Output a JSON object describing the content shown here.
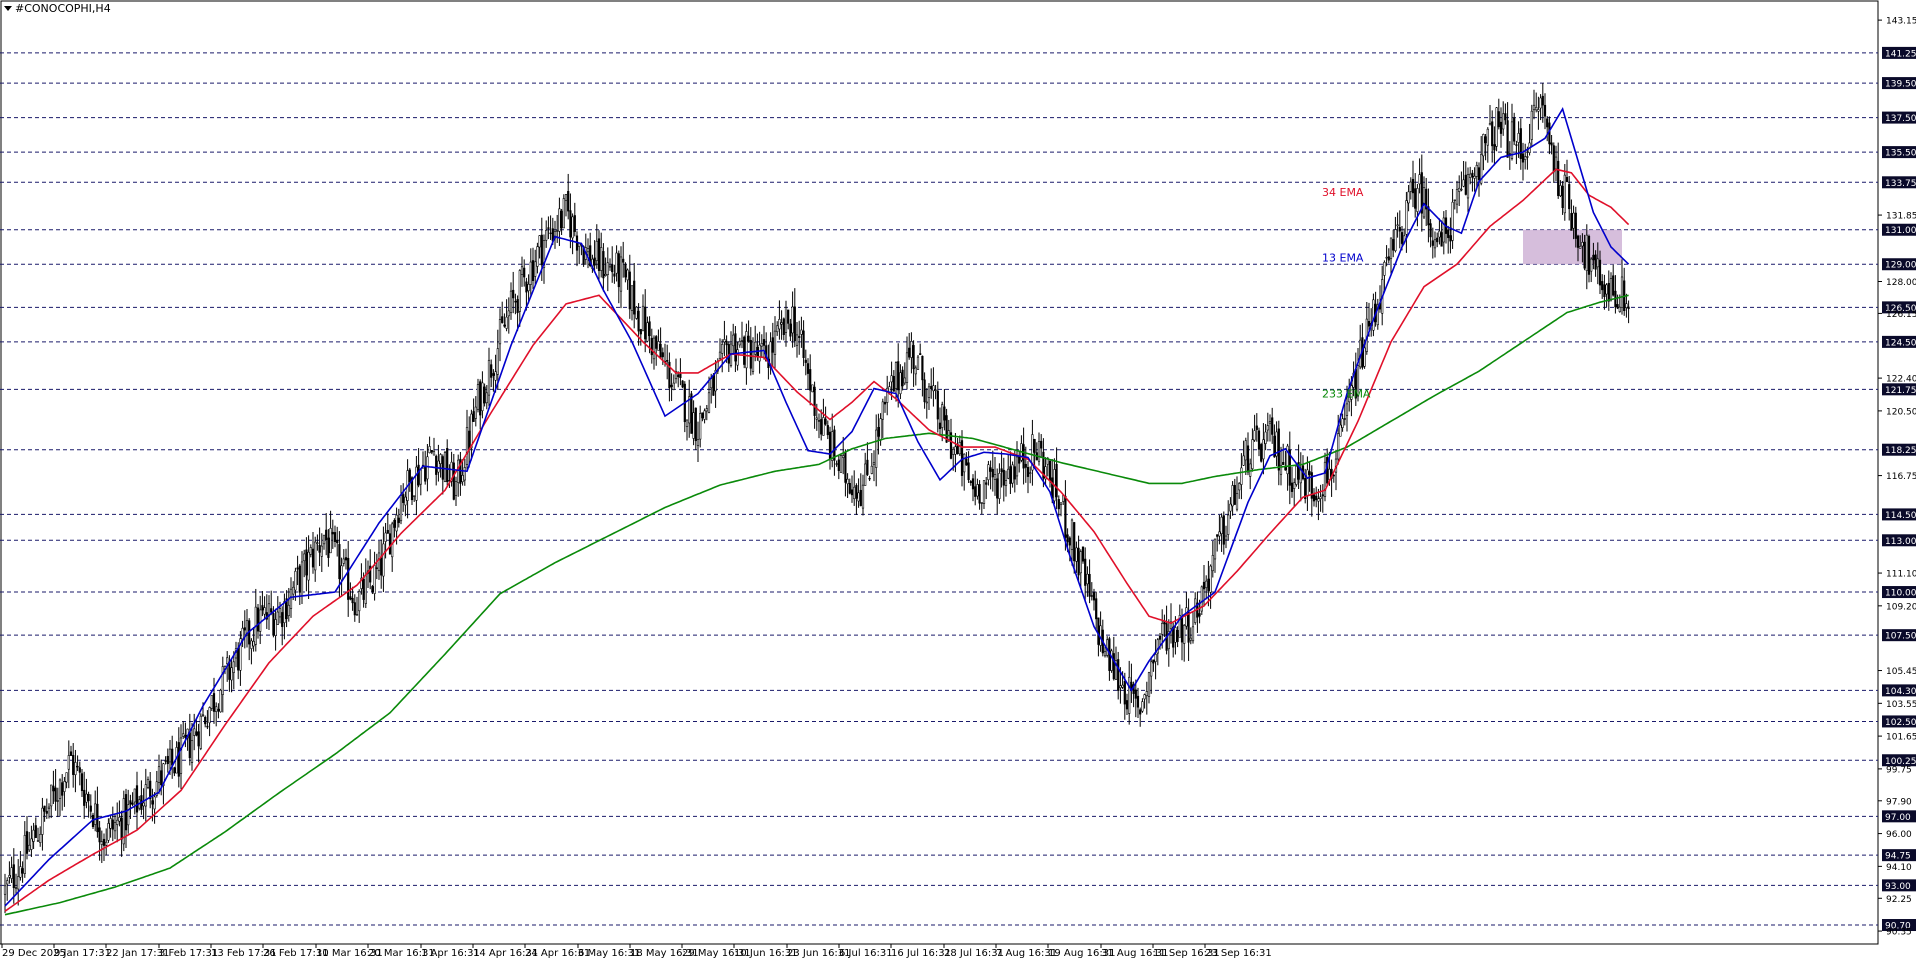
{
  "window": {
    "symbol_title": "#CONOCOPHI,H4"
  },
  "colors": {
    "ema13": "#0000cc",
    "ema34": "#e0102a",
    "ema233": "#0a8a0a",
    "zone": "#c8a8d0",
    "grid": "#1a1a6a",
    "level_box": "#0a0a2a"
  },
  "chart_data": {
    "type": "candlestick",
    "title": "#CONOCOPHI,H4",
    "ylim": [
      89.6,
      144.2
    ],
    "y_ticks": [
      "143.15",
      "131.85",
      "128.00",
      "126.15",
      "122.40",
      "120.50",
      "116.75",
      "111.10",
      "109.20",
      "105.45",
      "103.55",
      "101.65",
      "99.75",
      "97.90",
      "96.00",
      "94.10",
      "92.25",
      "90.35"
    ],
    "levels": [
      "141.25",
      "139.50",
      "137.50",
      "135.50",
      "133.75",
      "131.00",
      "129.00",
      "126.50",
      "124.50",
      "121.75",
      "118.25",
      "114.50",
      "113.00",
      "110.00",
      "107.50",
      "104.30",
      "102.50",
      "100.25",
      "97.00",
      "94.75",
      "93.00",
      "90.70"
    ],
    "x_labels": [
      "29 Dec 2025",
      "9 Jan 17:31",
      "22 Jan 17:31",
      "3 Feb 17:31",
      "13 Feb 17:31",
      "26 Feb 17:31",
      "10 Mar 16:31",
      "20 Mar 16:31",
      "1 Apr 16:31",
      "14 Apr 16:31",
      "24 Apr 16:31",
      "6 May 16:31",
      "18 May 16:31",
      "29 May 16:31",
      "10 Jun 16:31",
      "23 Jun 16:31",
      "6 Jul 16:31",
      "16 Jul 16:31",
      "28 Jul 16:31",
      "7 Aug 16:31",
      "19 Aug 16:31",
      "31 Aug 16:31",
      "11 Sep 16:31",
      "23 Sep 16:31"
    ],
    "anchors": {
      "close": [
        [
          0,
          92.6
        ],
        [
          15,
          96.2
        ],
        [
          30,
          100.3
        ],
        [
          45,
          95.9
        ],
        [
          55,
          97.0
        ],
        [
          65,
          98.5
        ],
        [
          80,
          100.4
        ],
        [
          95,
          103.8
        ],
        [
          115,
          108.4
        ],
        [
          125,
          108.8
        ],
        [
          145,
          113.3
        ],
        [
          160,
          109.4
        ],
        [
          170,
          111.2
        ],
        [
          180,
          115.6
        ],
        [
          195,
          118.2
        ],
        [
          205,
          116.0
        ],
        [
          215,
          121.0
        ],
        [
          230,
          126.5
        ],
        [
          245,
          130.4
        ],
        [
          255,
          132.0
        ],
        [
          265,
          129.5
        ],
        [
          280,
          128.4
        ],
        [
          292,
          125.0
        ],
        [
          302,
          122.6
        ],
        [
          315,
          119.6
        ],
        [
          330,
          124.5
        ],
        [
          345,
          123.5
        ],
        [
          358,
          126.0
        ],
        [
          370,
          120.0
        ],
        [
          380,
          117.0
        ],
        [
          390,
          116.0
        ],
        [
          402,
          121.5
        ],
        [
          412,
          124.0
        ],
        [
          425,
          120.0
        ],
        [
          440,
          116.0
        ],
        [
          450,
          116.5
        ],
        [
          460,
          117.5
        ],
        [
          470,
          118.2
        ],
        [
          480,
          115.0
        ],
        [
          490,
          111.0
        ],
        [
          500,
          106.5
        ],
        [
          510,
          104.2
        ],
        [
          515,
          103.0
        ],
        [
          525,
          107.5
        ],
        [
          540,
          108.4
        ],
        [
          555,
          114.0
        ],
        [
          565,
          118.0
        ],
        [
          575,
          118.8
        ],
        [
          585,
          117.0
        ],
        [
          595,
          116.0
        ],
        [
          605,
          117.5
        ],
        [
          617,
          124.0
        ],
        [
          630,
          129.5
        ],
        [
          642,
          133.7
        ],
        [
          652,
          130.0
        ],
        [
          665,
          133.8
        ],
        [
          678,
          137.0
        ],
        [
          690,
          135.5
        ],
        [
          698,
          138.5
        ],
        [
          705,
          134.5
        ],
        [
          712,
          132.0
        ],
        [
          722,
          128.5
        ],
        [
          730,
          127.5
        ],
        [
          738,
          126.9
        ]
      ],
      "ema13": [
        [
          0,
          91.8
        ],
        [
          20,
          94.5
        ],
        [
          40,
          96.8
        ],
        [
          55,
          97.3
        ],
        [
          70,
          98.4
        ],
        [
          90,
          103.4
        ],
        [
          110,
          107.6
        ],
        [
          130,
          109.7
        ],
        [
          150,
          110.0
        ],
        [
          170,
          114.0
        ],
        [
          190,
          117.3
        ],
        [
          210,
          117.0
        ],
        [
          230,
          124.3
        ],
        [
          250,
          130.6
        ],
        [
          262,
          130.2
        ],
        [
          272,
          127.5
        ],
        [
          285,
          124.5
        ],
        [
          300,
          120.2
        ],
        [
          315,
          121.5
        ],
        [
          330,
          123.8
        ],
        [
          345,
          124.0
        ],
        [
          355,
          121.0
        ],
        [
          365,
          118.2
        ],
        [
          375,
          118.0
        ],
        [
          385,
          119.3
        ],
        [
          395,
          121.8
        ],
        [
          405,
          121.5
        ],
        [
          415,
          118.7
        ],
        [
          425,
          116.5
        ],
        [
          435,
          117.7
        ],
        [
          445,
          118.1
        ],
        [
          455,
          118.0
        ],
        [
          465,
          117.8
        ],
        [
          475,
          115.8
        ],
        [
          485,
          111.7
        ],
        [
          495,
          108.0
        ],
        [
          505,
          105.8
        ],
        [
          512,
          104.3
        ],
        [
          520,
          106.0
        ],
        [
          535,
          108.6
        ],
        [
          550,
          110.0
        ],
        [
          565,
          115.2
        ],
        [
          575,
          117.9
        ],
        [
          582,
          118.3
        ],
        [
          592,
          116.6
        ],
        [
          600,
          116.9
        ],
        [
          610,
          121.5
        ],
        [
          622,
          125.8
        ],
        [
          635,
          130.0
        ],
        [
          645,
          132.5
        ],
        [
          655,
          131.2
        ],
        [
          662,
          130.8
        ],
        [
          670,
          133.8
        ],
        [
          680,
          135.2
        ],
        [
          690,
          135.5
        ],
        [
          700,
          136.3
        ],
        [
          708,
          138.0
        ],
        [
          715,
          135.0
        ],
        [
          722,
          132.0
        ],
        [
          730,
          130.0
        ],
        [
          738,
          129.0
        ]
      ],
      "ema34": [
        [
          0,
          91.5
        ],
        [
          20,
          93.3
        ],
        [
          40,
          94.8
        ],
        [
          60,
          96.2
        ],
        [
          80,
          98.5
        ],
        [
          100,
          102.3
        ],
        [
          120,
          105.9
        ],
        [
          140,
          108.6
        ],
        [
          160,
          110.4
        ],
        [
          180,
          113.4
        ],
        [
          200,
          115.9
        ],
        [
          220,
          120.2
        ],
        [
          240,
          124.3
        ],
        [
          255,
          126.7
        ],
        [
          270,
          127.2
        ],
        [
          290,
          124.5
        ],
        [
          305,
          122.7
        ],
        [
          315,
          122.7
        ],
        [
          330,
          123.8
        ],
        [
          345,
          123.6
        ],
        [
          360,
          121.6
        ],
        [
          375,
          120.0
        ],
        [
          385,
          121.0
        ],
        [
          395,
          122.2
        ],
        [
          405,
          121.2
        ],
        [
          420,
          119.4
        ],
        [
          435,
          118.4
        ],
        [
          450,
          118.4
        ],
        [
          465,
          117.7
        ],
        [
          480,
          115.8
        ],
        [
          495,
          113.5
        ],
        [
          510,
          110.5
        ],
        [
          520,
          108.6
        ],
        [
          530,
          108.2
        ],
        [
          545,
          109.2
        ],
        [
          560,
          111.2
        ],
        [
          575,
          113.4
        ],
        [
          590,
          115.5
        ],
        [
          600,
          115.9
        ],
        [
          615,
          119.9
        ],
        [
          630,
          124.5
        ],
        [
          645,
          127.7
        ],
        [
          660,
          129.0
        ],
        [
          675,
          131.2
        ],
        [
          690,
          132.7
        ],
        [
          705,
          134.5
        ],
        [
          712,
          134.3
        ],
        [
          720,
          133.0
        ],
        [
          730,
          132.3
        ],
        [
          738,
          131.3
        ]
      ],
      "ema233": [
        [
          0,
          91.3
        ],
        [
          25,
          92.0
        ],
        [
          50,
          92.9
        ],
        [
          75,
          94.0
        ],
        [
          100,
          96.1
        ],
        [
          125,
          98.4
        ],
        [
          150,
          100.6
        ],
        [
          175,
          103.0
        ],
        [
          200,
          106.4
        ],
        [
          225,
          109.9
        ],
        [
          250,
          111.7
        ],
        [
          275,
          113.3
        ],
        [
          300,
          114.9
        ],
        [
          325,
          116.2
        ],
        [
          350,
          117.0
        ],
        [
          370,
          117.4
        ],
        [
          385,
          118.3
        ],
        [
          400,
          118.9
        ],
        [
          420,
          119.2
        ],
        [
          440,
          118.9
        ],
        [
          460,
          118.2
        ],
        [
          480,
          117.5
        ],
        [
          500,
          116.9
        ],
        [
          520,
          116.3
        ],
        [
          535,
          116.3
        ],
        [
          550,
          116.7
        ],
        [
          570,
          117.1
        ],
        [
          590,
          117.4
        ],
        [
          610,
          118.4
        ],
        [
          630,
          119.9
        ],
        [
          650,
          121.4
        ],
        [
          670,
          122.8
        ],
        [
          690,
          124.5
        ],
        [
          710,
          126.2
        ],
        [
          725,
          126.8
        ],
        [
          738,
          127.2
        ]
      ]
    },
    "ema_labels": {
      "ema13": "13 EMA",
      "ema34": "34 EMA",
      "ema233": "233 EMA"
    },
    "zone": {
      "x_start": 690,
      "x_end": 735,
      "y_low": 129.0,
      "y_high": 131.0
    }
  }
}
